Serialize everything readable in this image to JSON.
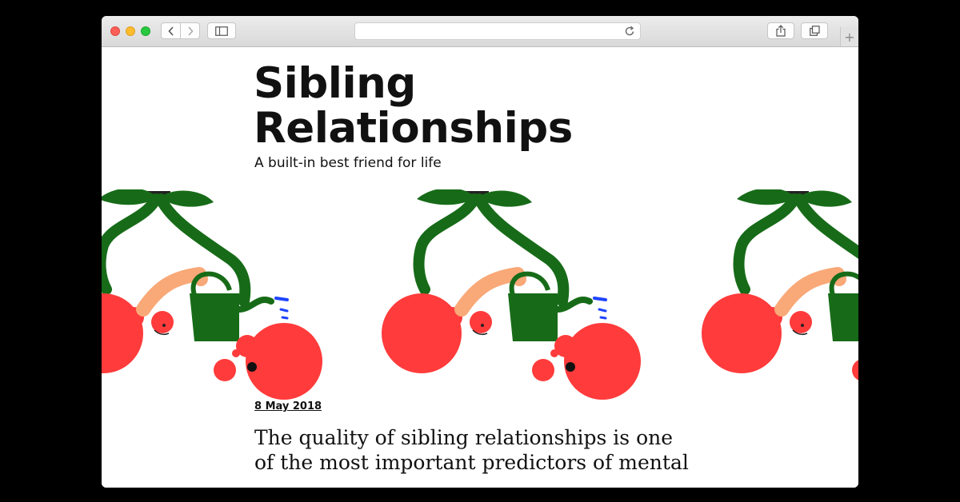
{
  "colors": {
    "cherry": "#ff3b3b",
    "leaf": "#176b18",
    "can": "#176b18",
    "hand": "#f9a877",
    "water": "#1d44ff"
  },
  "browser": {
    "icons": [
      "back-icon",
      "forward-icon",
      "sidebar-icon",
      "reload-icon",
      "share-icon",
      "tabs-icon",
      "plus-icon"
    ],
    "new_tab_glyph": "+"
  },
  "article": {
    "title_line1": "Sibling",
    "title_line2": "Relationships",
    "subtitle": "A built-in best friend for life",
    "date": "8 May 2018",
    "lead_line1": "The quality of sibling relationships is one",
    "lead_line2": "of the most important predictors of mental"
  }
}
